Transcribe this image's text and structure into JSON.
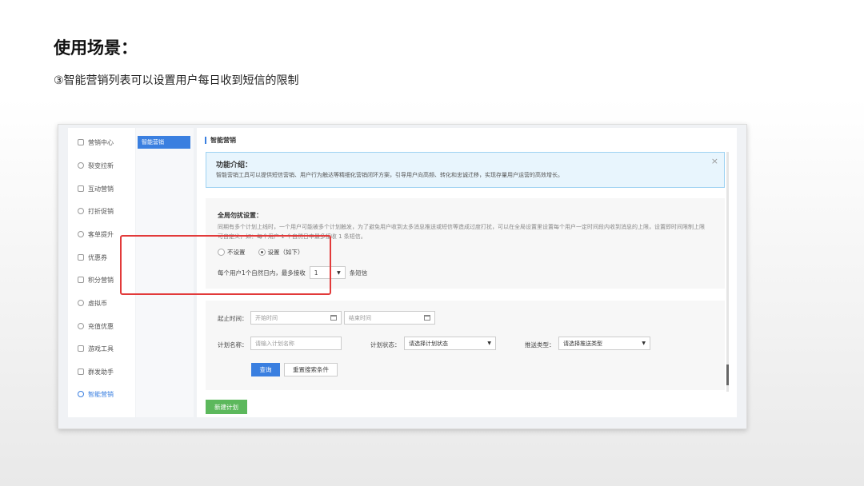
{
  "slide": {
    "title": "使用场景：",
    "subtitle": "③智能营销列表可以设置用户每日收到短信的限制"
  },
  "nav": {
    "items": [
      {
        "label": "营销中心",
        "icon": "check-square-icon"
      },
      {
        "label": "裂变拉新",
        "icon": "fission-icon"
      },
      {
        "label": "互动营销",
        "icon": "send-icon"
      },
      {
        "label": "打折促销",
        "icon": "discount-icon"
      },
      {
        "label": "客单提升",
        "icon": "cart-icon"
      },
      {
        "label": "优惠券",
        "icon": "coupon-icon"
      },
      {
        "label": "积分营销",
        "icon": "points-icon"
      },
      {
        "label": "虚拟币",
        "icon": "coin-icon"
      },
      {
        "label": "充值优惠",
        "icon": "recharge-icon"
      },
      {
        "label": "游戏工具",
        "icon": "game-icon"
      },
      {
        "label": "群发助手",
        "icon": "broadcast-icon"
      },
      {
        "label": "智能营销",
        "icon": "gear-icon",
        "active": true
      }
    ]
  },
  "subnav": {
    "active_label": "智能营销"
  },
  "main": {
    "title": "智能营销",
    "info": {
      "title": "功能介绍：",
      "desc": "智能营销工具可以提供短信营销、用户行为触达等精细化营销闭环方案，引导用户向高频、转化和忠诚迁移，实现存量用户运营的高效增长。",
      "close": "×"
    },
    "global": {
      "title": "全局勿扰设置：",
      "desc": "同期有多个计划上线时，一个用户可能被多个计划触发，为了避免用户收到太多消息推送或短信等造成过度打扰，可以在全局设置里设置每个用户一定时间段内收到消息的上限，设置即时间限制上限可自定义，如：每个用户 1 个自然日中最多接收 1 条短信。",
      "option_off": "不设置",
      "option_on": "设置（如下）",
      "limit_prefix": "每个用户1个自然日内，最多接收",
      "limit_value": "1",
      "limit_suffix": "条短信"
    },
    "filters": {
      "date_label": "起止时间：",
      "start_placeholder": "开始时间",
      "end_placeholder": "结束时间",
      "name_label": "计划名称：",
      "name_placeholder": "请输入计划名称",
      "status_label": "计划状态：",
      "status_value": "请选择计划状态",
      "type_label": "推送类型：",
      "type_value": "请选择推送类型",
      "query": "查询",
      "reset": "重置搜索条件"
    },
    "new_plan": "新建计划"
  },
  "colors": {
    "accent": "#3a7fe0",
    "highlight": "#e23a3a",
    "success": "#5cb85c"
  }
}
